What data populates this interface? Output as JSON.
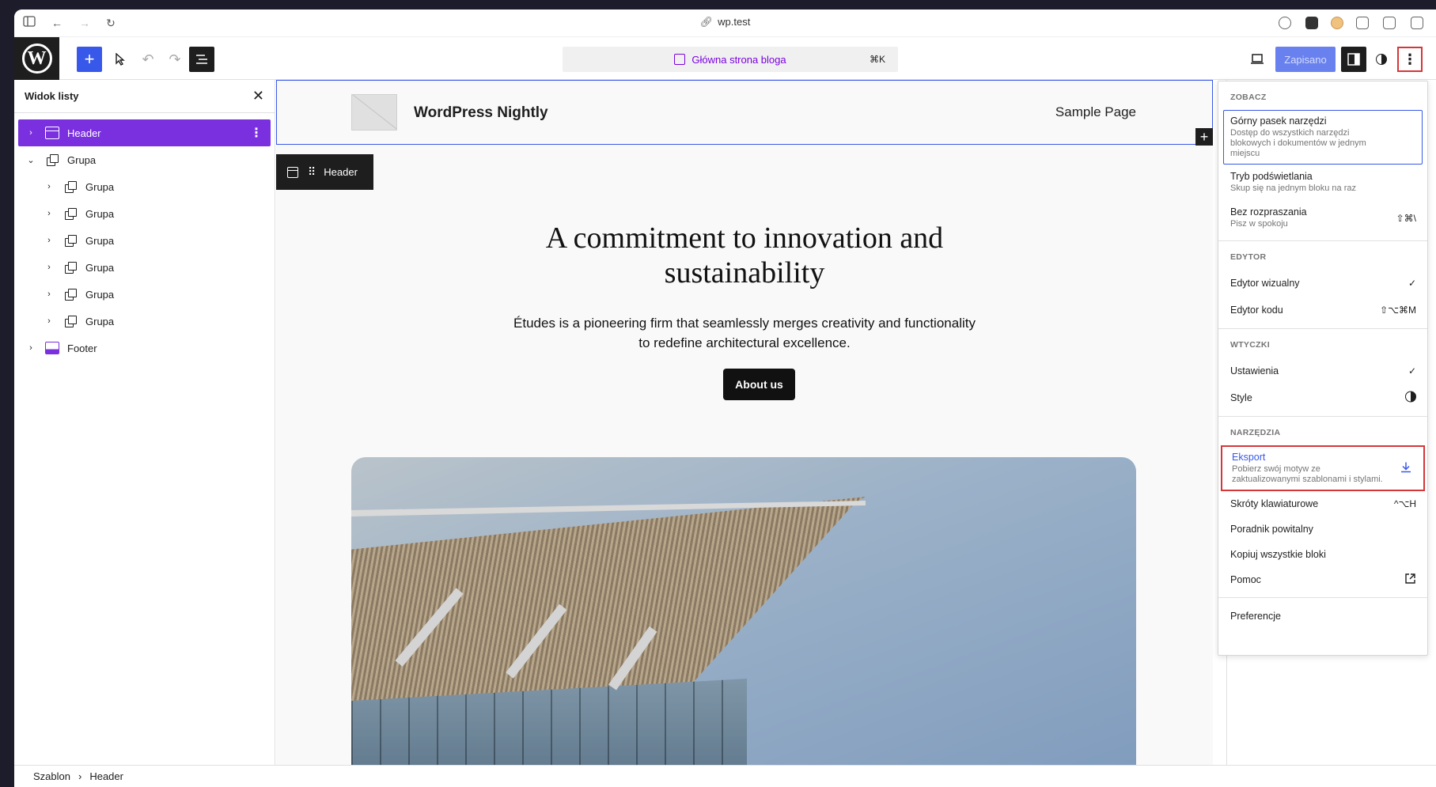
{
  "browser": {
    "url": "wp.test"
  },
  "toolbar": {
    "command": "Główna strona bloga",
    "command_shortcut": "⌘K",
    "save_label": "Zapisano"
  },
  "sidebar": {
    "title": "Widok listy",
    "items": [
      {
        "label": "Header"
      },
      {
        "label": "Grupa"
      },
      {
        "label": "Grupa"
      },
      {
        "label": "Grupa"
      },
      {
        "label": "Grupa"
      },
      {
        "label": "Grupa"
      },
      {
        "label": "Grupa"
      },
      {
        "label": "Grupa"
      },
      {
        "label": "Footer"
      }
    ]
  },
  "canvas": {
    "site_title": "WordPress Nightly",
    "nav_link": "Sample Page",
    "block_toolbar_label": "Header",
    "hero_title_line1": "A commitment to innovation and",
    "hero_title_line2": "sustainability",
    "hero_text_line1": "Études is a pioneering firm that seamlessly merges creativity and functionality",
    "hero_text_line2": "to redefine architectural excellence.",
    "button": "About us"
  },
  "breadcrumbs": {
    "root": "Szablon",
    "separator": "›",
    "current": "Header"
  },
  "menu": {
    "view": {
      "title": "Zobacz",
      "top_toolbar": {
        "label": "Górny pasek narzędzi",
        "desc": "Dostęp do wszystkich narzędzi blokowych i dokumentów w jednym miejscu"
      },
      "spotlight": {
        "label": "Tryb podświetlania",
        "desc": "Skup się na jednym bloku na raz"
      },
      "distraction_free": {
        "label": "Bez rozpraszania",
        "desc": "Pisz w spokoju",
        "shortcut": "⇧⌘\\"
      }
    },
    "editor": {
      "title": "Edytor",
      "visual": {
        "label": "Edytor wizualny",
        "check": "✓"
      },
      "code": {
        "label": "Edytor kodu",
        "shortcut": "⇧⌥⌘M"
      }
    },
    "plugins": {
      "title": "Wtyczki",
      "settings": {
        "label": "Ustawienia",
        "check": "✓"
      },
      "styles": {
        "label": "Style"
      }
    },
    "tools": {
      "title": "Narzędzia",
      "export": {
        "label": "Eksport",
        "desc": "Pobierz swój motyw ze zaktualizowanymi szablonami i stylami."
      },
      "shortcuts": {
        "label": "Skróty klawiaturowe",
        "shortcut": "^⌥H"
      },
      "welcome": {
        "label": "Poradnik powitalny"
      },
      "copy_all": {
        "label": "Kopiuj wszystkie bloki"
      },
      "help": {
        "label": "Pomoc"
      }
    },
    "preferences": {
      "label": "Preferencje"
    }
  },
  "colors": {
    "accent": "#3858e9",
    "selection": "#7a30df",
    "highlight_box": "#d63638"
  }
}
